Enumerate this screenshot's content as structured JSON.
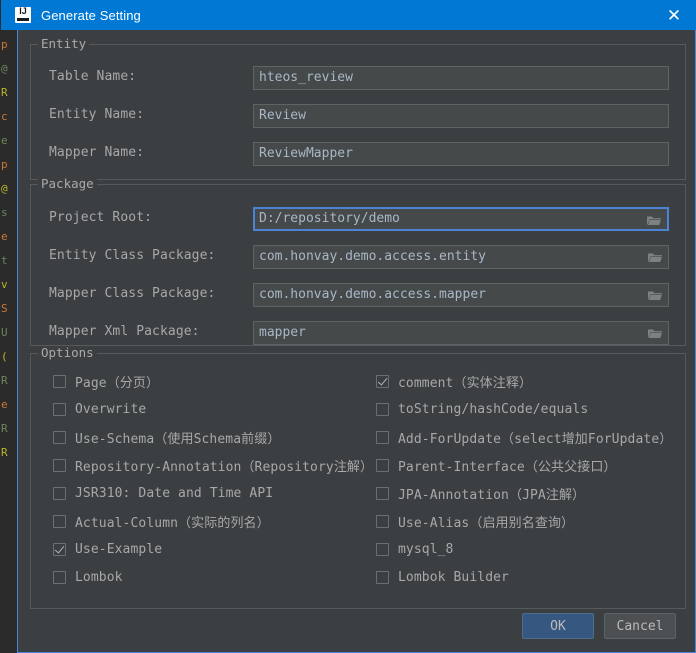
{
  "window": {
    "title": "Generate Setting",
    "app_icon": "intellij-idea-icon",
    "close_label": "✕",
    "titlebar_color": "#0078d4",
    "background_color": "#3c3f41"
  },
  "entity_group": {
    "title": "Entity",
    "fields": [
      {
        "label": "Table Name:",
        "value": "hteos_review",
        "focused": false,
        "browse": false
      },
      {
        "label": "Entity Name:",
        "value": "Review",
        "focused": false,
        "browse": false
      },
      {
        "label": "Mapper Name:",
        "value": "ReviewMapper",
        "focused": false,
        "browse": false
      }
    ]
  },
  "package_group": {
    "title": "Package",
    "fields": [
      {
        "label": "Project Root:",
        "value": "D:/repository/demo",
        "focused": true,
        "browse": true
      },
      {
        "label": "Entity Class Package:",
        "value": "com.honvay.demo.access.entity",
        "focused": false,
        "browse": true
      },
      {
        "label": "Mapper Class Package:",
        "value": "com.honvay.demo.access.mapper",
        "focused": false,
        "browse": true
      },
      {
        "label": "Mapper Xml Package:",
        "value": "mapper",
        "focused": false,
        "browse": true
      }
    ]
  },
  "options_group": {
    "title": "Options",
    "left_column": [
      {
        "label": "Page（分页）",
        "checked": false
      },
      {
        "label": "Overwrite",
        "checked": false
      },
      {
        "label": "Use-Schema（使用Schema前缀）",
        "checked": false
      },
      {
        "label": "Repository-Annotation（Repository注解）",
        "checked": false
      },
      {
        "label": "JSR310: Date and Time API",
        "checked": false
      },
      {
        "label": "Actual-Column（实际的列名）",
        "checked": false
      },
      {
        "label": "Use-Example",
        "checked": true
      },
      {
        "label": "Lombok",
        "checked": false
      }
    ],
    "right_column": [
      {
        "label": "comment（实体注释）",
        "checked": true
      },
      {
        "label": "toString/hashCode/equals",
        "checked": false
      },
      {
        "label": "Add-ForUpdate（select增加ForUpdate）",
        "checked": false
      },
      {
        "label": "Parent-Interface（公共父接口）",
        "checked": false
      },
      {
        "label": "JPA-Annotation（JPA注解）",
        "checked": false
      },
      {
        "label": "Use-Alias（启用别名查询）",
        "checked": false
      },
      {
        "label": "mysql_8",
        "checked": false
      },
      {
        "label": "Lombok Builder",
        "checked": false
      }
    ]
  },
  "buttons": {
    "ok": "OK",
    "cancel": "Cancel",
    "ok_color": "#365880"
  }
}
